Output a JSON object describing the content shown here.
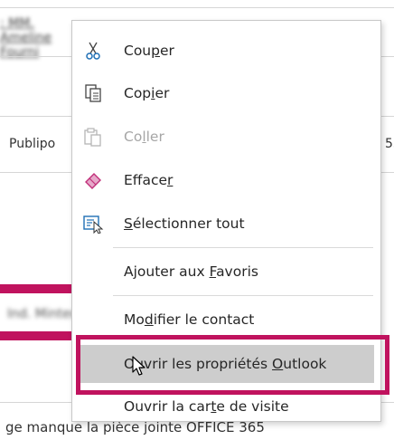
{
  "background": {
    "recipient_partial": ": MM. Ameline Fourni",
    "publipo_text": "Publipo",
    "right_partial": "55",
    "blurred_contact": "Ind. Minted",
    "bottom_text": "ge manque la  pièce jointe OFFICE 365"
  },
  "menu": {
    "items": [
      {
        "pre": "Cou",
        "acc": "p",
        "post": "er",
        "icon": "scissors-icon"
      },
      {
        "pre": "Cop",
        "acc": "i",
        "post": "er",
        "icon": "copy-icon"
      },
      {
        "pre": "Co",
        "acc": "l",
        "post": "ler",
        "icon": "paste-icon",
        "disabled": true
      },
      {
        "pre": "Efface",
        "acc": "r",
        "post": "",
        "icon": "eraser-icon"
      },
      {
        "pre": "",
        "acc": "S",
        "post": "électionner tout",
        "icon": "select-all-icon"
      },
      {
        "pre": "Ajouter aux ",
        "acc": "F",
        "post": "avoris"
      },
      {
        "pre": "Mo",
        "acc": "d",
        "post": "ifier le contact"
      },
      {
        "pre": "Ouvrir les propriétés ",
        "acc": "O",
        "post": "utlook"
      },
      {
        "pre": "Ouvrir la car",
        "acc": "t",
        "post": "e de visite"
      }
    ]
  },
  "colors": {
    "accent_pink": "#c0135e",
    "highlight_gray": "#cdcdcd",
    "icon_blue": "#1f6fb5",
    "icon_pink": "#c2307a"
  }
}
